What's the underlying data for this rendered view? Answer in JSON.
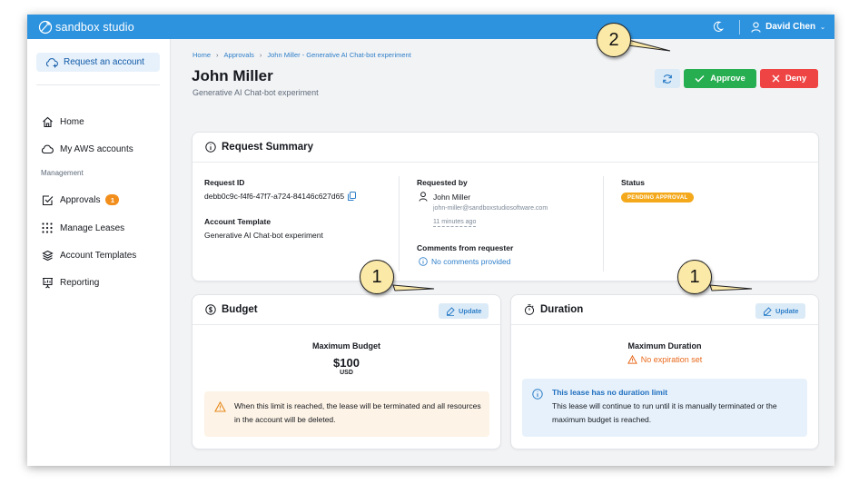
{
  "app": {
    "name": "sandbox studio"
  },
  "topbar": {
    "user_name": "David Chen"
  },
  "sidebar": {
    "request_button": "Request an account",
    "items": [
      {
        "label": "Home",
        "icon": "home-icon"
      },
      {
        "label": "My AWS accounts",
        "icon": "cloud-icon"
      }
    ],
    "section_label": "Management",
    "management_items": [
      {
        "label": "Approvals",
        "icon": "checkbox-icon",
        "badge": "1"
      },
      {
        "label": "Manage Leases",
        "icon": "grid-dots-icon"
      },
      {
        "label": "Account Templates",
        "icon": "layers-icon"
      },
      {
        "label": "Reporting",
        "icon": "presentation-icon"
      }
    ]
  },
  "breadcrumb": [
    "Home",
    "Approvals",
    "John Miller - Generative AI Chat-bot experiment"
  ],
  "page": {
    "title": "John Miller",
    "subtitle": "Generative AI Chat-bot experiment"
  },
  "actions": {
    "approve": "Approve",
    "deny": "Deny"
  },
  "summary": {
    "title": "Request Summary",
    "request_id_label": "Request ID",
    "request_id": "debb0c9c-f4f6-47f7-a724-84146c627d65",
    "template_label": "Account Template",
    "template": "Generative AI Chat-bot experiment",
    "requested_by_label": "Requested by",
    "requester_name": "John Miller",
    "requester_email": "john-miller@sandboxstudiosoftware.com",
    "requested_time": "11 minutes ago",
    "comments_label": "Comments from requester",
    "comments": "No comments provided",
    "status_label": "Status",
    "status": "PENDING APPROVAL"
  },
  "budget": {
    "title": "Budget",
    "update": "Update",
    "max_label": "Maximum Budget",
    "amount": "$100",
    "currency": "USD",
    "warning": "When this limit is reached, the lease will be terminated and all resources in the account will be deleted."
  },
  "duration": {
    "title": "Duration",
    "update": "Update",
    "max_label": "Maximum Duration",
    "no_expiration": "No expiration set",
    "info_title": "This lease has no duration limit",
    "info_text": "This lease will continue to run until it is manually terminated or the maximum budget is reached."
  },
  "callouts": {
    "budget_update": "1",
    "duration_update": "1",
    "approve": "2"
  },
  "colors": {
    "topbar": "#2e93de",
    "approve": "#27ae51",
    "deny": "#ef4444",
    "status": "#f4a91c",
    "badge": "#f28e1c"
  }
}
